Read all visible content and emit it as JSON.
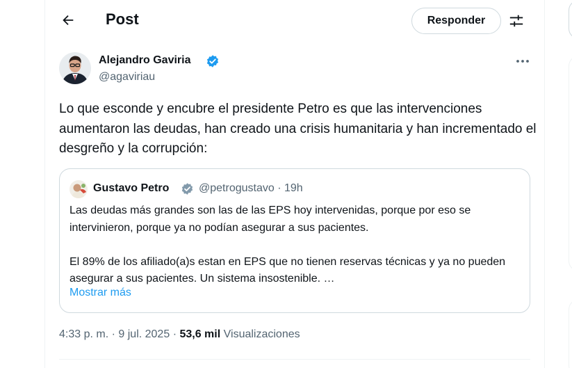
{
  "header": {
    "title": "Post",
    "reply_label": "Responder"
  },
  "post": {
    "author_name": "Alejandro Gaviria",
    "author_handle": "@agaviriau",
    "text": "Lo que esconde y encubre el presidente Petro es que las intervenciones aumentaron las deudas, han creado una crisis humanitaria y han incrementado el desgreño y la corrupción:",
    "time": "4:33 p. m.",
    "date": "9 jul. 2025",
    "separator": "·",
    "views_count": "53,6 mil",
    "views_label": "Visualizaciones"
  },
  "quote": {
    "author_name": "Gustavo Petro",
    "author_handle": "@petrogustavo",
    "time_ago": "19h",
    "text": "Las deudas más grandes son las de las EPS  hoy intervenidas, porque por eso se intervinieron, porque ya no podían asegurar a sus pacientes.\n\nEl 89% de los afiliado(a)s estan en EPS que no tienen reservas técnicas y ya no pueden asegurar a sus pacientes. Un sistema insostenible. …",
    "show_more": "Mostrar más"
  },
  "icons": {
    "back": "arrow-left-icon",
    "filter": "sliders-icon",
    "more": "more-horizontal-icon",
    "verified": "verified-badge-icon"
  },
  "colors": {
    "accent": "#1d9bf0",
    "verified_blue": "#1d9bf0",
    "verified_gray": "#829aab",
    "secondary_text": "#536471"
  }
}
